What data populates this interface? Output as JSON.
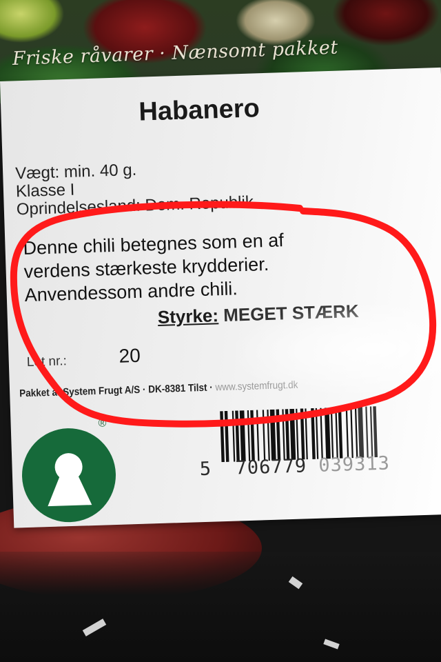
{
  "packaging": {
    "tagline": "Friske råvarer · Nænsomt pakket"
  },
  "label": {
    "product_name": "Habanero",
    "weight": "Vægt: min. 40 g.",
    "class": "Klasse I",
    "origin": "Oprindelsesland: Dom. Republik",
    "description_lines": [
      "Denne chili betegnes som en af",
      "verdens stærkeste krydderier.",
      "Anvendessom andre chili."
    ],
    "strength_label": "Styrke:",
    "strength_value": "MEGET STÆRK",
    "lot_label": "Lot nr.:",
    "lot_value": "20",
    "packer": "Pakket af System Frugt A/S · DK-8381 Tilst · ",
    "packer_domain": "www.systemfrugt.dk"
  },
  "logo": {
    "name": "keyhole-logo",
    "color": "#166a3a",
    "registered_mark": "®"
  },
  "barcode": {
    "first_digit": "5",
    "group1": "706779",
    "group2": "039313"
  },
  "annotation": {
    "shape": "hand-drawn-ellipse",
    "color": "#ff1a1a"
  }
}
